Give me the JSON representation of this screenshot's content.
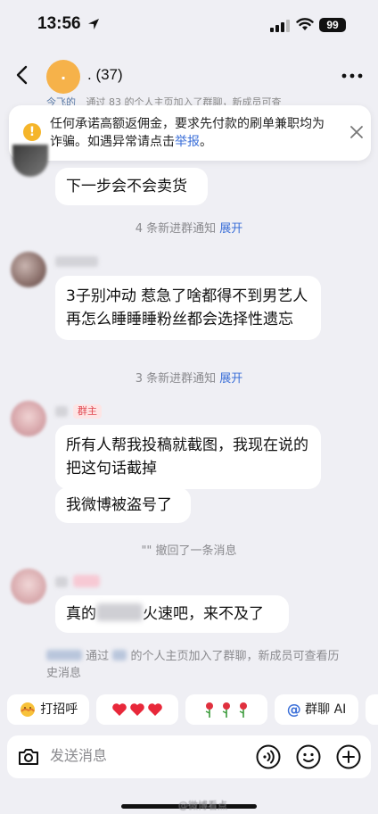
{
  "status_bar": {
    "time": "13:56",
    "battery": "99"
  },
  "nav": {
    "avatar_text": ".",
    "title": ". (37)"
  },
  "peek": {
    "left_name": "今飞的",
    "text": "通过 83 的个人主页加入了群聊，新成员可查"
  },
  "warning": {
    "text": "任何承诺高额返佣金，要求先付款的刷单兼职均为诈骗。如遇异常请点击",
    "link": "举报",
    "suffix": "。"
  },
  "messages": [
    {
      "text": "下一步会不会卖货"
    },
    {
      "notice": "4 条新进群通知",
      "action": "展开"
    },
    {
      "text": "3子别冲动 惹急了啥都得不到男艺人再怎么睡睡睡粉丝都会选择性遗忘"
    },
    {
      "notice": "3 条新进群通知",
      "action": "展开"
    },
    {
      "badge": "群主",
      "text": "所有人帮我投稿就截图，我现在说的把这句话截掉",
      "text2": "我微博被盗号了"
    },
    {
      "recall": "\"\" 撤回了一条消息"
    },
    {
      "text_before": "真的",
      "text_after": "火速吧，来不及了"
    }
  ],
  "join_notice": {
    "part1": "通过",
    "part2": "的个人主页加入了群聊，新成员可查看历史消息"
  },
  "quick_actions": [
    {
      "label": "打招呼",
      "icon": "wave-emoji-icon"
    },
    {
      "label": "",
      "icon": "hearts-emoji-icon"
    },
    {
      "label": "",
      "icon": "roses-emoji-icon"
    },
    {
      "label": "群聊 AI",
      "icon": "at-icon"
    }
  ],
  "input": {
    "placeholder": "发送消息"
  },
  "watermark": "@微博看点",
  "colors": {
    "accent": "#3b6fd8",
    "warning": "#f5b52a",
    "owner_badge": "#e0464f",
    "background": "#efeff4"
  }
}
